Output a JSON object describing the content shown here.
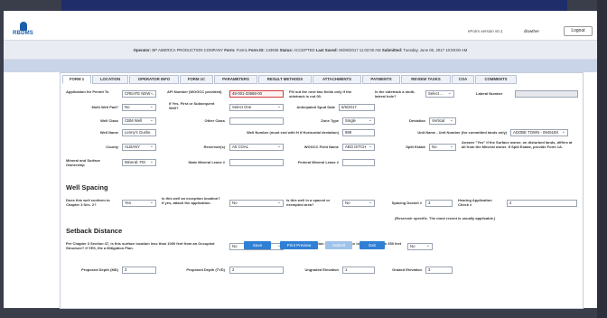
{
  "header": {
    "logo_text": "RBDMS",
    "version": "eForm version v0.1",
    "user": "dlowther",
    "logout_label": "Logout"
  },
  "infobar": {
    "operator_label": "Operator:",
    "operator": "BP AMERICA PRODUCTION COMPANY",
    "form_label": "Form:",
    "form": "Form1",
    "form_id_label": "Form ID:",
    "form_id": "143936",
    "status_label": "Status:",
    "status": "ACCEPTED",
    "last_saved_label": "Last Saved:",
    "last_saved": "06/06/2017 11:02:00 AM",
    "submitted_label": "Submitted:",
    "submitted": "Tuesday, June 06, 2017 10:59:00 AM"
  },
  "tabs": [
    "FORM 1",
    "LOCATION",
    "OPERATOR INFO",
    "FORM 1C",
    "PARAMETERS",
    "RESULT METHODS",
    "ATTACHMENTS",
    "PAYMENTS",
    "REVIEW TASKS",
    "COA",
    "COMMENTS"
  ],
  "fields": {
    "app_permit_label": "Application for Permit To",
    "app_permit": "CREATE NEW ...",
    "api_label": "API Number (WOGCC provided)",
    "api": "49-001-33569-00",
    "fill_note": "Fill out the next two fields only if the sidetrack is not 00.",
    "sidetrack_label": "Is the sidetrack a multi-lateral hole?",
    "sidetrack": "Select ...",
    "lateral_label": "Lateral Number",
    "lateral": "",
    "multi_pad_label": "Multi Well Pad?",
    "multi_pad": "No",
    "first_well_label": "If Yes, First or Subsequent Well?",
    "first_well": "Select One",
    "spud_label": "Anticipated Spud Date",
    "spud": "6/6/2017",
    "well_class_label": "Well Class",
    "well_class": "CBM Well",
    "other_class_label": "Other Class",
    "other_class": "",
    "zone_type_label": "Zone Type",
    "zone_type": "Single",
    "deviation_label": "Deviation",
    "deviation": "Vertical",
    "well_name_label": "Well Name",
    "well_name": "Lenny's Gushe",
    "well_number_label": "Well Number (must end with H if Horizontal deviation)",
    "well_number": "999",
    "unit_name_label": "Unit Name - Unit Number (for committed lands only)",
    "unit_name": "ADOBE TOWN - 094518X",
    "county_label": "County",
    "county": "ALBANY",
    "reservoir_label": "Reservoir(s)",
    "reservoir": "A5 COAL",
    "field_name_label": "WOGCC Field Name",
    "field_name": "ABO DITCH",
    "split_estate_label": "Split Estate",
    "split_estate": "No",
    "split_note": "Answer \"Yes\" if the Surface owner, on disturbed lands, differs at all from the Mineral owner. If Split Estate, provide Form 1A.",
    "mineral_label": "Mineral and Surface Ownership",
    "mineral": "Mineral: FEI",
    "state_lease_label": "State Mineral Lease #",
    "state_lease": "",
    "fed_lease_label": "Federal Mineral Lease #",
    "fed_lease": ""
  },
  "spacing": {
    "title": "Well Spacing",
    "conform_label": "Does this well conform to Chapter 3 Sec. 2?",
    "conform": "Yes",
    "exception_label": "Is this well an exception location? If yes, attach the application.",
    "exception": "No",
    "spaced_label": "Is this well in a spaced or exempted area?",
    "spaced": "No",
    "docket_label": "Spacing Docket #",
    "docket": "3",
    "hearing_label": "Hearing Application Check #",
    "hearing": "2",
    "reservoir_note": "(Reservoir specific. The most recent is usually applicable.)"
  },
  "setback": {
    "title": "Setback Distance",
    "sec47_label": "Per Chapter 3 Section 47, is this surface location less than 1000 feet from an Occupied Structure? If YES, file a Mitigation Plan.",
    "sec47": "No",
    "sec22_label": "Per Chapter 3 Section 22, is this surface location less than 350 feet from water?",
    "sec22": "No"
  },
  "depths": {
    "md_label": "Proposed Depth (MD)",
    "md": "3",
    "tvd_label": "Proposed Depth (TVD)",
    "tvd": "2",
    "ungraded_label": "Ungraded Elevation",
    "ungraded": "1",
    "graded_label": "Graded Elevation",
    "graded": "3"
  },
  "buttons": {
    "save": "Save",
    "print": "Print Preview",
    "submit": "Submit",
    "exit": "Exit"
  }
}
